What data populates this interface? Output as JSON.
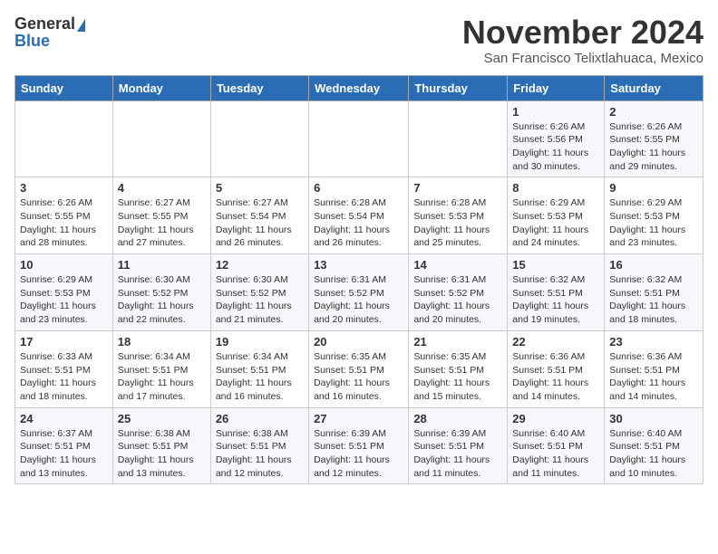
{
  "header": {
    "logo_general": "General",
    "logo_blue": "Blue",
    "month_title": "November 2024",
    "location": "San Francisco Telixtlahuaca, Mexico"
  },
  "weekdays": [
    "Sunday",
    "Monday",
    "Tuesday",
    "Wednesday",
    "Thursday",
    "Friday",
    "Saturday"
  ],
  "weeks": [
    [
      {
        "day": "",
        "info": ""
      },
      {
        "day": "",
        "info": ""
      },
      {
        "day": "",
        "info": ""
      },
      {
        "day": "",
        "info": ""
      },
      {
        "day": "",
        "info": ""
      },
      {
        "day": "1",
        "info": "Sunrise: 6:26 AM\nSunset: 5:56 PM\nDaylight: 11 hours and 30 minutes."
      },
      {
        "day": "2",
        "info": "Sunrise: 6:26 AM\nSunset: 5:55 PM\nDaylight: 11 hours and 29 minutes."
      }
    ],
    [
      {
        "day": "3",
        "info": "Sunrise: 6:26 AM\nSunset: 5:55 PM\nDaylight: 11 hours and 28 minutes."
      },
      {
        "day": "4",
        "info": "Sunrise: 6:27 AM\nSunset: 5:55 PM\nDaylight: 11 hours and 27 minutes."
      },
      {
        "day": "5",
        "info": "Sunrise: 6:27 AM\nSunset: 5:54 PM\nDaylight: 11 hours and 26 minutes."
      },
      {
        "day": "6",
        "info": "Sunrise: 6:28 AM\nSunset: 5:54 PM\nDaylight: 11 hours and 26 minutes."
      },
      {
        "day": "7",
        "info": "Sunrise: 6:28 AM\nSunset: 5:53 PM\nDaylight: 11 hours and 25 minutes."
      },
      {
        "day": "8",
        "info": "Sunrise: 6:29 AM\nSunset: 5:53 PM\nDaylight: 11 hours and 24 minutes."
      },
      {
        "day": "9",
        "info": "Sunrise: 6:29 AM\nSunset: 5:53 PM\nDaylight: 11 hours and 23 minutes."
      }
    ],
    [
      {
        "day": "10",
        "info": "Sunrise: 6:29 AM\nSunset: 5:53 PM\nDaylight: 11 hours and 23 minutes."
      },
      {
        "day": "11",
        "info": "Sunrise: 6:30 AM\nSunset: 5:52 PM\nDaylight: 11 hours and 22 minutes."
      },
      {
        "day": "12",
        "info": "Sunrise: 6:30 AM\nSunset: 5:52 PM\nDaylight: 11 hours and 21 minutes."
      },
      {
        "day": "13",
        "info": "Sunrise: 6:31 AM\nSunset: 5:52 PM\nDaylight: 11 hours and 20 minutes."
      },
      {
        "day": "14",
        "info": "Sunrise: 6:31 AM\nSunset: 5:52 PM\nDaylight: 11 hours and 20 minutes."
      },
      {
        "day": "15",
        "info": "Sunrise: 6:32 AM\nSunset: 5:51 PM\nDaylight: 11 hours and 19 minutes."
      },
      {
        "day": "16",
        "info": "Sunrise: 6:32 AM\nSunset: 5:51 PM\nDaylight: 11 hours and 18 minutes."
      }
    ],
    [
      {
        "day": "17",
        "info": "Sunrise: 6:33 AM\nSunset: 5:51 PM\nDaylight: 11 hours and 18 minutes."
      },
      {
        "day": "18",
        "info": "Sunrise: 6:34 AM\nSunset: 5:51 PM\nDaylight: 11 hours and 17 minutes."
      },
      {
        "day": "19",
        "info": "Sunrise: 6:34 AM\nSunset: 5:51 PM\nDaylight: 11 hours and 16 minutes."
      },
      {
        "day": "20",
        "info": "Sunrise: 6:35 AM\nSunset: 5:51 PM\nDaylight: 11 hours and 16 minutes."
      },
      {
        "day": "21",
        "info": "Sunrise: 6:35 AM\nSunset: 5:51 PM\nDaylight: 11 hours and 15 minutes."
      },
      {
        "day": "22",
        "info": "Sunrise: 6:36 AM\nSunset: 5:51 PM\nDaylight: 11 hours and 14 minutes."
      },
      {
        "day": "23",
        "info": "Sunrise: 6:36 AM\nSunset: 5:51 PM\nDaylight: 11 hours and 14 minutes."
      }
    ],
    [
      {
        "day": "24",
        "info": "Sunrise: 6:37 AM\nSunset: 5:51 PM\nDaylight: 11 hours and 13 minutes."
      },
      {
        "day": "25",
        "info": "Sunrise: 6:38 AM\nSunset: 5:51 PM\nDaylight: 11 hours and 13 minutes."
      },
      {
        "day": "26",
        "info": "Sunrise: 6:38 AM\nSunset: 5:51 PM\nDaylight: 11 hours and 12 minutes."
      },
      {
        "day": "27",
        "info": "Sunrise: 6:39 AM\nSunset: 5:51 PM\nDaylight: 11 hours and 12 minutes."
      },
      {
        "day": "28",
        "info": "Sunrise: 6:39 AM\nSunset: 5:51 PM\nDaylight: 11 hours and 11 minutes."
      },
      {
        "day": "29",
        "info": "Sunrise: 6:40 AM\nSunset: 5:51 PM\nDaylight: 11 hours and 11 minutes."
      },
      {
        "day": "30",
        "info": "Sunrise: 6:40 AM\nSunset: 5:51 PM\nDaylight: 11 hours and 10 minutes."
      }
    ]
  ]
}
